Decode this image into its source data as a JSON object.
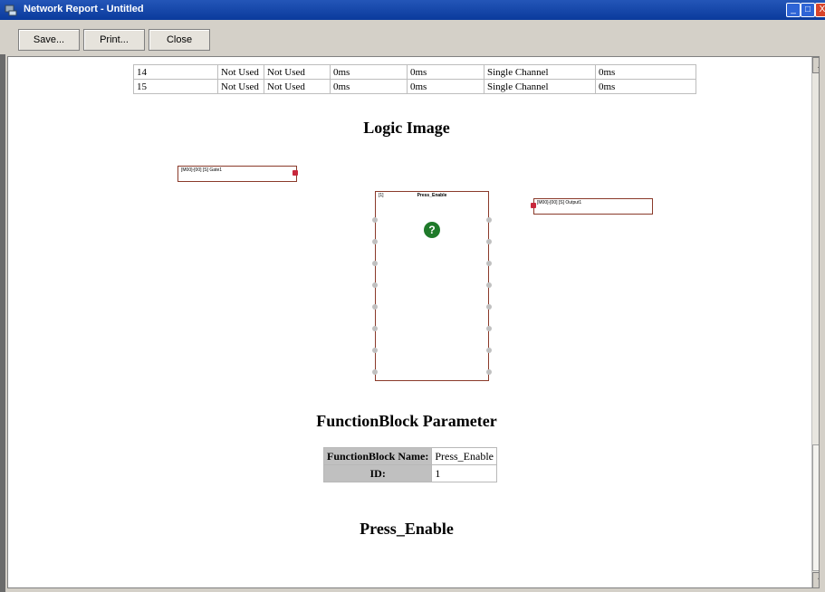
{
  "window": {
    "title": "Network Report - Untitled",
    "min_glyph": "_",
    "max_glyph": "□",
    "close_glyph": "X"
  },
  "toolbar": {
    "save_label": "Save...",
    "print_label": "Print...",
    "close_label": "Close"
  },
  "port_table": {
    "rows": [
      [
        "14",
        "",
        "Not Used",
        "Not Used",
        "0ms",
        "0ms",
        "Single Channel",
        "0ms"
      ],
      [
        "15",
        "",
        "Not Used",
        "Not Used",
        "0ms",
        "0ms",
        "Single Channel",
        "0ms"
      ]
    ]
  },
  "logic": {
    "heading": "Logic Image",
    "input_node": "[M00]-[00] [S] Gate1",
    "output_node": "[M00]-[00] [S] Output1",
    "block_number": "[1]",
    "block_name": "Press_Enable",
    "block_icon": "question-icon"
  },
  "fb_params": {
    "heading": "FunctionBlock Parameter",
    "rows": [
      {
        "key": "FunctionBlock Name:",
        "value": "Press_Enable"
      },
      {
        "key": "ID:",
        "value": "1"
      }
    ]
  },
  "footer_heading": "Press_Enable",
  "scrollbar": {
    "up_glyph": "▲",
    "down_glyph": "▼"
  }
}
